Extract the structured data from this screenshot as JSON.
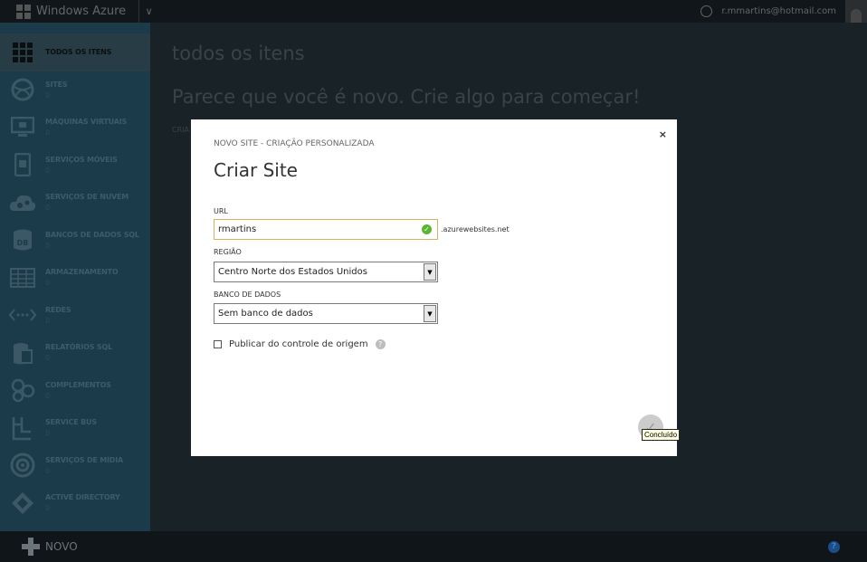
{
  "topbar": {
    "brand": "Windows Azure",
    "user_email": "r.mmartins@hotmail.com"
  },
  "sidebar": {
    "items": [
      {
        "label": "TODOS OS ITENS",
        "count": "",
        "icon": "grid-icon",
        "active": true
      },
      {
        "label": "SITES",
        "count": "0",
        "icon": "web-sites-icon"
      },
      {
        "label": "MÁQUINAS VIRTUAIS",
        "count": "0",
        "icon": "monitor-icon"
      },
      {
        "label": "SERVIÇOS MÓVEIS",
        "count": "0",
        "icon": "mobile-icon"
      },
      {
        "label": "SERVIÇOS DE NUVEM",
        "count": "0",
        "icon": "cloud-gears-icon"
      },
      {
        "label": "BANCOS DE DADOS SQL",
        "count": "0",
        "icon": "database-icon"
      },
      {
        "label": "ARMAZENAMENTO",
        "count": "0",
        "icon": "table-icon"
      },
      {
        "label": "REDES",
        "count": "0",
        "icon": "network-icon"
      },
      {
        "label": "RELATÓRIOS SQL",
        "count": "0",
        "icon": "report-icon"
      },
      {
        "label": "COMPLEMENTOS",
        "count": "0",
        "icon": "addons-icon"
      },
      {
        "label": "SERVICE BUS",
        "count": "0",
        "icon": "service-bus-icon"
      },
      {
        "label": "SERVIÇOS DE MÍDIA",
        "count": "0",
        "icon": "media-icon"
      },
      {
        "label": "ACTIVE DIRECTORY",
        "count": "0",
        "icon": "directory-icon"
      }
    ]
  },
  "main": {
    "title": "todos os itens",
    "intro": "Parece que você é novo. Crie algo para começar!",
    "create_link": "CRIA"
  },
  "dialog": {
    "subtitle": "NOVO SITE - CRIAÇÃO PERSONALIZADA",
    "title": "Criar Site",
    "url_label": "URL",
    "url_value": "rmartins",
    "url_suffix": ".azurewebsites.net",
    "region_label": "REGIÃO",
    "region_value": "Centro Norte dos Estados Unidos",
    "db_label": "BANCO DE DADOS",
    "db_value": "Sem banco de dados",
    "publish_label": "Publicar do controle de origem",
    "close": "×",
    "tooltip": "Concluído"
  },
  "bottombar": {
    "new_label": "NOVO",
    "help": "?"
  }
}
